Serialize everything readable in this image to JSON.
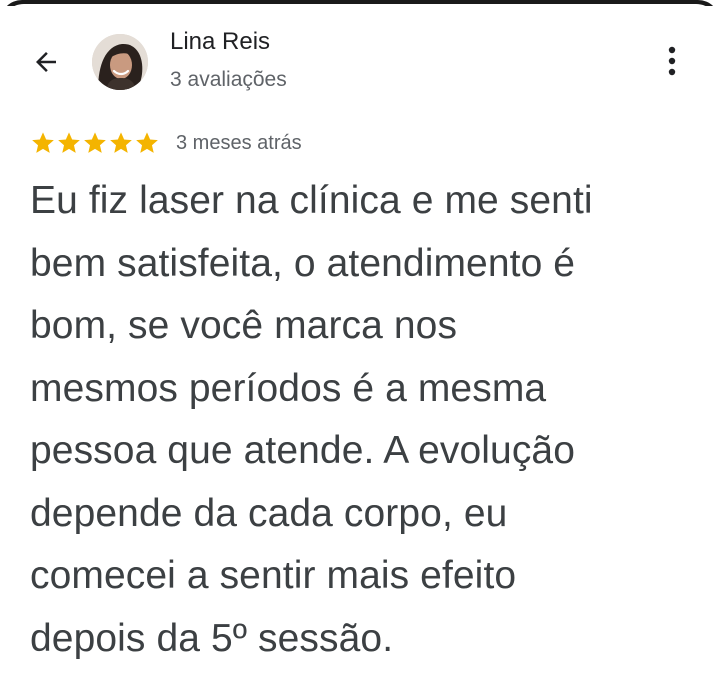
{
  "header": {
    "reviewer_name": "Lina Reis",
    "reviewer_review_count": "3 avaliações",
    "back_icon": "arrow-left-icon",
    "more_icon": "more-vertical-icon"
  },
  "review": {
    "rating": 5,
    "rating_max": 5,
    "star_color": "#F4B400",
    "date": "3 meses atrás",
    "lines": [
      "Eu fiz laser na clínica e me senti",
      "bem satisfeita, o atendimento é",
      "bom, se você marca nos",
      "mesmos períodos é a mesma",
      "pessoa que atende. A evolução",
      "depende da cada corpo, eu",
      "comecei a sentir mais efeito",
      "depois da 5º sessão."
    ]
  }
}
